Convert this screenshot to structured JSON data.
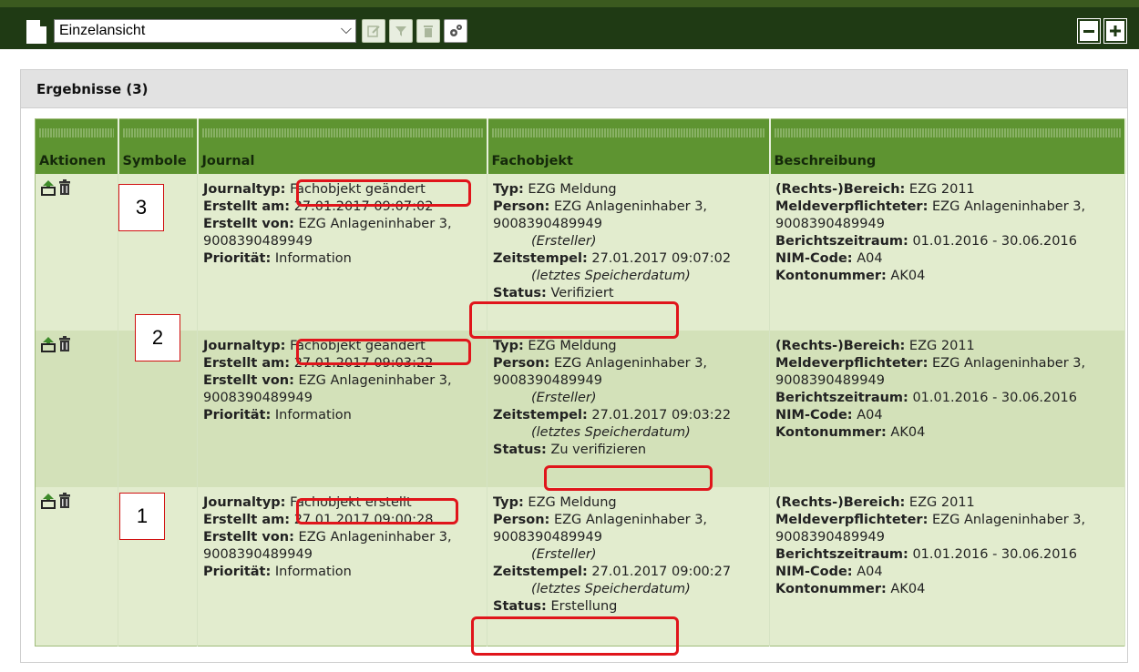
{
  "toolbar": {
    "view_select_value": "Einzelansicht",
    "buttons": [
      "document-icon",
      "edit-icon",
      "filter-icon",
      "trash-icon",
      "settings-icon"
    ],
    "window_buttons": [
      "collapse-icon",
      "expand-icon"
    ]
  },
  "results": {
    "heading": "Ergebnisse (3)",
    "columns": [
      "Aktionen",
      "Symbole",
      "Journal",
      "Fachobjekt",
      "Beschreibung"
    ]
  },
  "labels": {
    "journaltyp": "Journaltyp:",
    "erstellt_am": "Erstellt am:",
    "erstellt_von": "Erstellt von:",
    "prioritaet": "Priorität:",
    "typ": "Typ:",
    "person": "Person:",
    "ersteller": "(Ersteller)",
    "zeitstempel": "Zeitstempel:",
    "letztes": "(letztes Speicherdatum)",
    "status": "Status:",
    "bereich": "(Rechts-)Bereich:",
    "melde": "Meldeverpflichteter:",
    "berichtszeitraum": "Berichtszeitraum:",
    "nim": "NIM-Code:",
    "konto": "Kontonummer:"
  },
  "rows": [
    {
      "journaltyp": "Fachobjekt geändert",
      "erstellt_am": "27.01.2017 09:07:02",
      "erstellt_von": "EZG Anlageninhaber 3, 9008390489949",
      "prioritaet": "Information",
      "typ": "EZG Meldung",
      "person": "EZG Anlageninhaber 3, 9008390489949",
      "zeitstempel": "27.01.2017 09:07:02",
      "status": "Verifiziert",
      "bereich": "EZG 2011",
      "melde": "EZG Anlageninhaber 3, 9008390489949",
      "berichtszeitraum": "01.01.2016 - 30.06.2016",
      "nim": "A04",
      "konto": "AK04"
    },
    {
      "journaltyp": "Fachobjekt geändert",
      "erstellt_am": "27.01.2017 09:03:22",
      "erstellt_von": "EZG Anlageninhaber 3, 9008390489949",
      "prioritaet": "Information",
      "typ": "EZG Meldung",
      "person": "EZG Anlageninhaber 3, 9008390489949",
      "zeitstempel": "27.01.2017 09:03:22",
      "status": "Zu verifizieren",
      "bereich": "EZG 2011",
      "melde": "EZG Anlageninhaber 3, 9008390489949",
      "berichtszeitraum": "01.01.2016 - 30.06.2016",
      "nim": "A04",
      "konto": "AK04"
    },
    {
      "journaltyp": "Fachobjekt erstellt",
      "erstellt_am": "27.01.2017 09:00:28",
      "erstellt_von": "EZG Anlageninhaber 3, 9008390489949",
      "prioritaet": "Information",
      "typ": "EZG Meldung",
      "person": "EZG Anlageninhaber 3, 9008390489949",
      "zeitstempel": "27.01.2017 09:00:27",
      "status": "Erstellung",
      "bereich": "EZG 2011",
      "melde": "EZG Anlageninhaber 3, 9008390489949",
      "berichtszeitraum": "01.01.2016 - 30.06.2016",
      "nim": "A04",
      "konto": "AK04"
    }
  ],
  "annotations": {
    "numbers": [
      "3",
      "2",
      "1"
    ],
    "highlight_color": "#e0151b"
  },
  "colors": {
    "toolbar_bg": "#1f3a14",
    "header_green": "#5e9431",
    "row_light": "#e2ecce",
    "row_dark": "#d3e1b9"
  }
}
